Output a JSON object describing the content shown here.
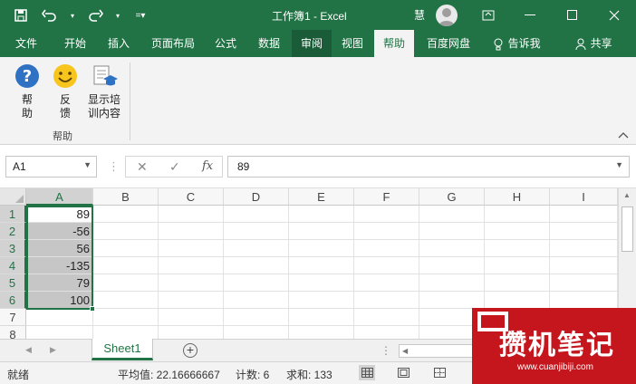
{
  "titlebar": {
    "doc_title": "工作簿1  -  Excel",
    "user_name": "慧",
    "qat": [
      "save-icon",
      "undo-icon",
      "redo-icon",
      "customize-icon"
    ],
    "window_buttons": [
      "ribbon-display-icon",
      "minimize-icon",
      "maximize-icon",
      "close-icon"
    ]
  },
  "tabs": [
    "文件",
    "开始",
    "插入",
    "页面布局",
    "公式",
    "数据",
    "审阅",
    "视图",
    "帮助",
    "百度网盘",
    "告诉我",
    "共享"
  ],
  "active_tab": "帮助",
  "ribbon": {
    "buttons": [
      {
        "label": "帮\n助",
        "icon": "help-icon"
      },
      {
        "label": "反\n馈",
        "icon": "smiley-icon"
      },
      {
        "label": "显示培\n训内容",
        "icon": "training-icon"
      }
    ],
    "group_label": "帮助"
  },
  "formula_bar": {
    "name_box": "A1",
    "formula_value": "89",
    "fx": "fx"
  },
  "grid": {
    "columns": [
      "A",
      "B",
      "C",
      "D",
      "E",
      "F",
      "G",
      "H",
      "I"
    ],
    "rows": [
      "1",
      "2",
      "3",
      "4",
      "5",
      "6",
      "7",
      "8"
    ],
    "column_a_values": [
      "89",
      "-56",
      "56",
      "-135",
      "79",
      "100"
    ],
    "selected_range": "A1:A6"
  },
  "sheets": {
    "tabs": [
      "Sheet1"
    ],
    "add_label": "+"
  },
  "status": {
    "ready": "就绪",
    "average": "平均值: 22.16666667",
    "count": "计数: 6",
    "sum": "求和: 133"
  },
  "watermark": {
    "title": "攒机笔记",
    "url": "www.cuanjibiji.com"
  },
  "colors": {
    "brand": "#217346",
    "selection_fill": "#c6c6c6",
    "watermark": "#c4161c"
  }
}
